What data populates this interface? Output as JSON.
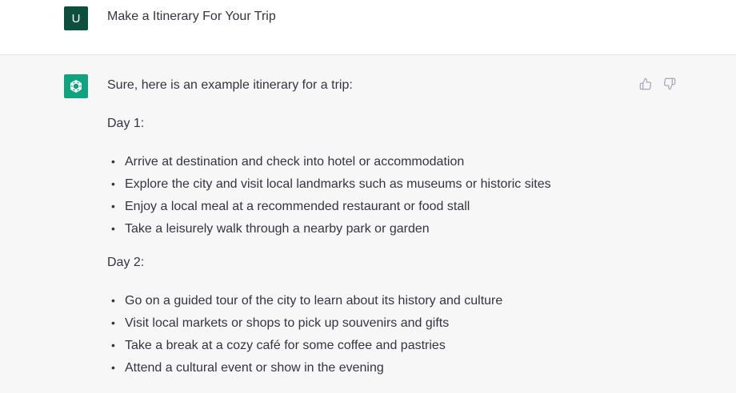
{
  "user": {
    "avatar_letter": "U",
    "avatar_color": "#0b4f3c",
    "message": "Make a Itinerary For Your Trip"
  },
  "assistant": {
    "avatar_color": "#10a37f",
    "icon": "openai-logo-icon",
    "intro": "Sure, here is an example itinerary for a trip:",
    "days": [
      {
        "label": "Day 1:",
        "items": [
          "Arrive at destination and check into hotel or accommodation",
          "Explore the city and visit local landmarks such as museums or historic sites",
          "Enjoy a local meal at a recommended restaurant or food stall",
          "Take a leisurely walk through a nearby park or garden"
        ]
      },
      {
        "label": "Day 2:",
        "items": [
          "Go on a guided tour of the city to learn about its history and culture",
          "Visit local markets or shops to pick up souvenirs and gifts",
          "Take a break at a cozy café for some coffee and pastries",
          "Attend a cultural event or show in the evening"
        ]
      }
    ]
  },
  "feedback": {
    "thumbs_up_icon": "thumbs-up-icon",
    "thumbs_down_icon": "thumbs-down-icon",
    "icon_color": "#acacbe"
  },
  "bullet_char": "•"
}
